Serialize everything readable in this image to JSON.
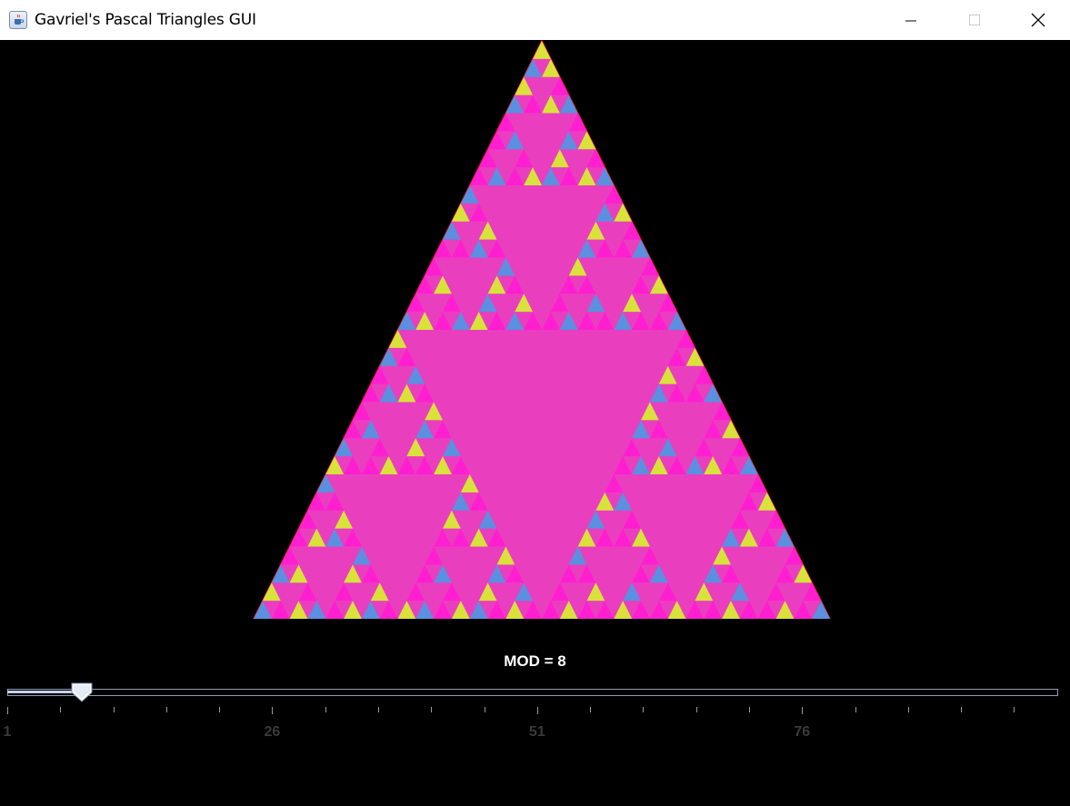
{
  "window": {
    "title": "Gavriel's Pascal Triangles GUI"
  },
  "icons": {
    "app": "java-coffee-icon",
    "minimize": "minimize-icon",
    "maximize": "maximize-icon",
    "close": "close-icon"
  },
  "mod_label": "MOD = 8",
  "slider": {
    "min": 1,
    "max": 100,
    "value": 8,
    "major_tick_labels": [
      "1",
      "26",
      "51",
      "76"
    ]
  },
  "colors": {
    "background": "#000000",
    "triangle_fill": "#e93fbf",
    "pattern_pink": "#ff1fd0",
    "pattern_blue": "#5b8fe0",
    "pattern_red": "#e0101a",
    "pattern_yellow": "#d9e23a"
  }
}
